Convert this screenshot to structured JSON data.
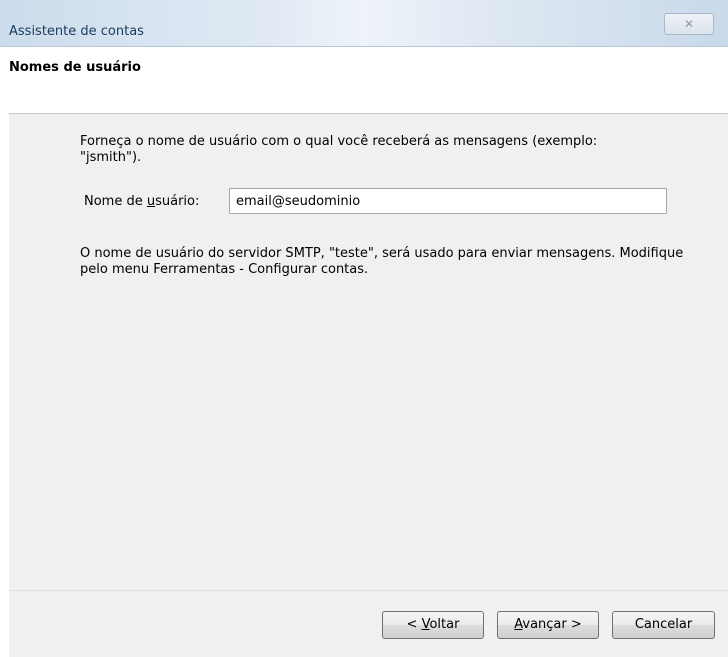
{
  "window": {
    "title": "Assistente de contas",
    "close_glyph": "✕"
  },
  "header": {
    "title": "Nomes de usuário"
  },
  "body": {
    "intro": "Forneça o nome de usuário com o qual você receberá as mensagens (exemplo: \"jsmith\").",
    "username_label_pre": "Nome de ",
    "username_label_key": "u",
    "username_label_post": "suário:",
    "username_value": "email@seudominio",
    "smtp_info": "O nome de usuário do servidor SMTP, \"teste\", será usado para enviar mensagens. Modifique pelo menu Ferramentas - Configurar contas."
  },
  "footer": {
    "back_pre": "< ",
    "back_key": "V",
    "back_post": "oltar",
    "next_key": "A",
    "next_post": "vançar >",
    "cancel_label": "Cancelar"
  }
}
